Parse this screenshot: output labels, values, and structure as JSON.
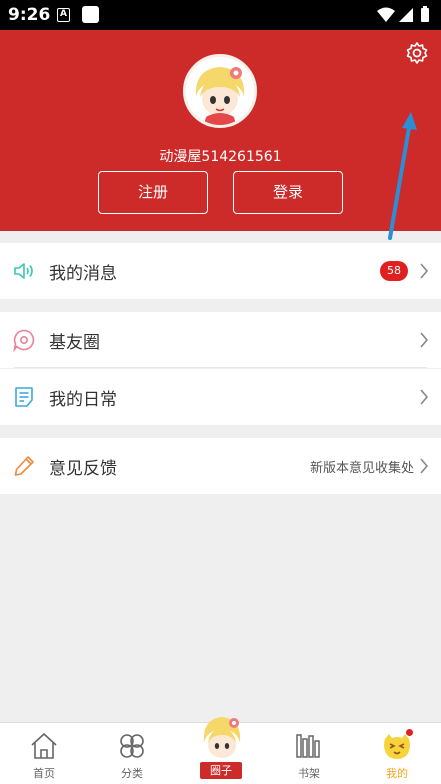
{
  "status_bar": {
    "time": "9:26",
    "a_icon_text": "A"
  },
  "header": {
    "username": "动漫屋514261561",
    "register_label": "注册",
    "login_label": "登录",
    "bg_color": "#cd2a2a"
  },
  "menu": {
    "messages": {
      "label": "我的消息",
      "badge": "58"
    },
    "friends": {
      "label": "基友圈"
    },
    "daily": {
      "label": "我的日常"
    },
    "feedback": {
      "label": "意见反馈",
      "extra": "新版本意见收集处"
    }
  },
  "bottom_nav": {
    "home": "首页",
    "category": "分类",
    "circle": "圈子",
    "bookshelf": "书架",
    "mine": "我的"
  },
  "icons": [
    "settings-icon",
    "speaker-icon",
    "chat-bubble-icon",
    "notes-icon",
    "pencil-icon",
    "home-icon",
    "clover-icon",
    "bookshelf-icon",
    "mascot-face-icon",
    "chevron-right-icon"
  ]
}
